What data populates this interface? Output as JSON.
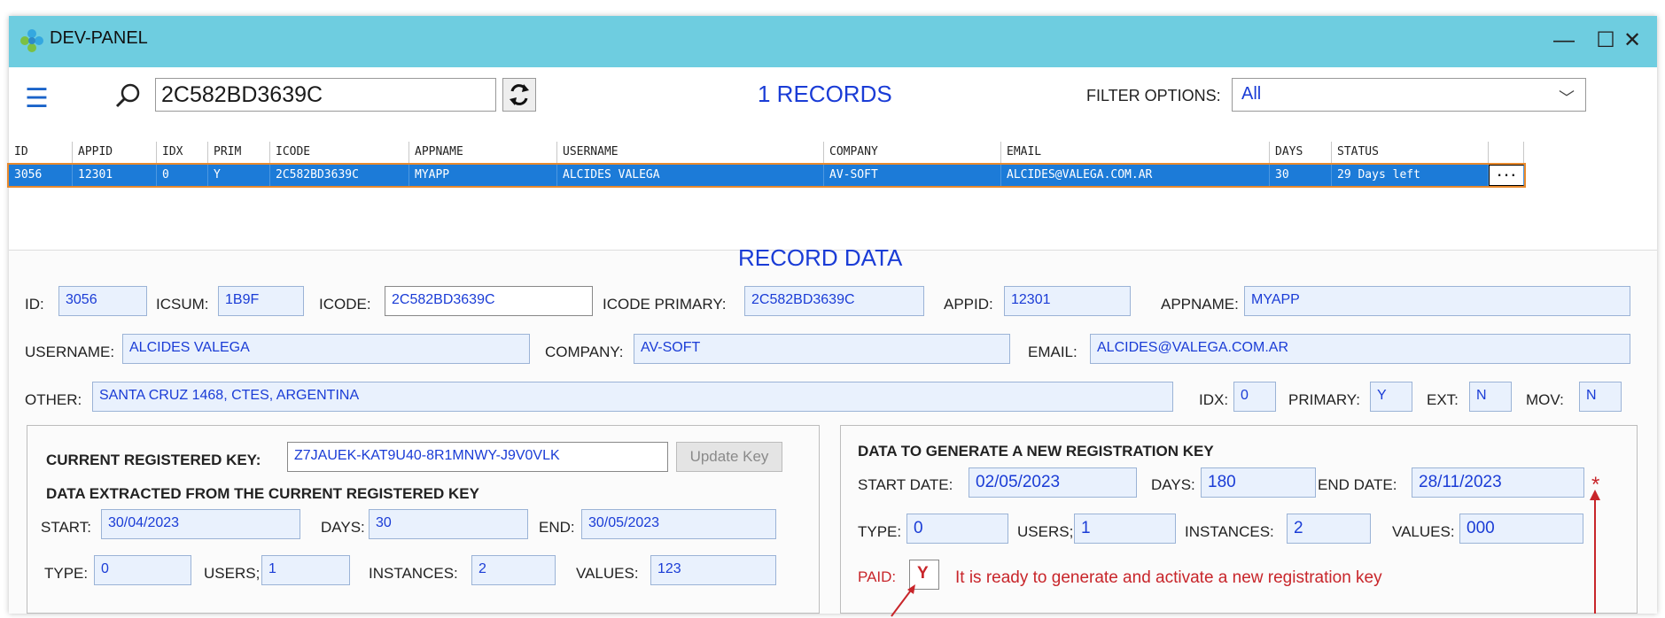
{
  "window": {
    "title": "DEV-PANEL",
    "controls": {
      "minimize": "—",
      "maximize": "☐",
      "close": "✕"
    }
  },
  "toolbar": {
    "search_value": "2C582BD3639C",
    "records_label": "1 RECORDS",
    "filter_label": "FILTER OPTIONS:",
    "filter_value": "All"
  },
  "grid": {
    "columns": [
      "ID",
      "APPID",
      "IDX",
      "PRIM",
      "ICODE",
      "APPNAME",
      "USERNAME",
      "COMPANY",
      "EMAIL",
      "DAYS",
      "STATUS"
    ],
    "rows": [
      [
        "3056",
        "12301",
        "0",
        "Y",
        "2C582BD3639C",
        "MYAPP",
        "ALCIDES VALEGA",
        "AV-SOFT",
        "ALCIDES@VALEGA.COM.AR",
        "30",
        "29 Days left"
      ]
    ],
    "row_action": "..."
  },
  "record": {
    "title": "RECORD DATA",
    "id_label": "ID:",
    "id": "3056",
    "icsum_label": "ICSUM:",
    "icsum": "1B9F",
    "icode_label": "ICODE:",
    "icode": "2C582BD3639C",
    "icode_primary_label": "ICODE PRIMARY:",
    "icode_primary": "2C582BD3639C",
    "appid_label": "APPID:",
    "appid": "12301",
    "appname_label": "APPNAME:",
    "appname": "MYAPP",
    "username_label": "USERNAME:",
    "username": "ALCIDES VALEGA",
    "company_label": "COMPANY:",
    "company": "AV-SOFT",
    "email_label": "EMAIL:",
    "email": "ALCIDES@VALEGA.COM.AR",
    "other_label": "OTHER:",
    "other": "SANTA CRUZ 1468, CTES, ARGENTINA",
    "idx_label": "IDX:",
    "idx": "0",
    "primary_label": "PRIMARY:",
    "primary": "Y",
    "ext_label": "EXT:",
    "ext": "N",
    "mov_label": "MOV:",
    "mov": "N"
  },
  "current_key": {
    "label": "CURRENT REGISTERED KEY:",
    "value": "Z7JAUEK-KAT9U40-8R1MNWY-J9V0VLK",
    "update_button": "Update Key",
    "extracted_title": "DATA EXTRACTED FROM THE CURRENT REGISTERED KEY",
    "start_label": "START:",
    "start": "30/04/2023",
    "days_label": "DAYS:",
    "days": "30",
    "end_label": "END:",
    "end": "30/05/2023",
    "type_label": "TYPE:",
    "type": "0",
    "users_label": "USERS;",
    "users": "1",
    "instances_label": "INSTANCES:",
    "instances": "2",
    "values_label": "VALUES:",
    "values": "123"
  },
  "new_key": {
    "title": "DATA TO GENERATE A NEW REGISTRATION KEY",
    "start_label": "START DATE:",
    "start": "02/05/2023",
    "days_label": "DAYS:",
    "days": "180",
    "end_label": "END DATE:",
    "end": "28/11/2023",
    "required_mark": "*",
    "type_label": "TYPE:",
    "type": "0",
    "users_label": "USERS;",
    "users": "1",
    "instances_label": "INSTANCES:",
    "instances": "2",
    "values_label": "VALUES:",
    "values": "000",
    "paid_label": "PAID:",
    "paid": "Y",
    "status_message": "It is ready to generate and activate a new registration key"
  },
  "colors": {
    "titlebar": "#6ecde0",
    "accent_blue": "#1a3cd6",
    "selection": "#1c7bd8",
    "alert_red": "#c8252a"
  }
}
